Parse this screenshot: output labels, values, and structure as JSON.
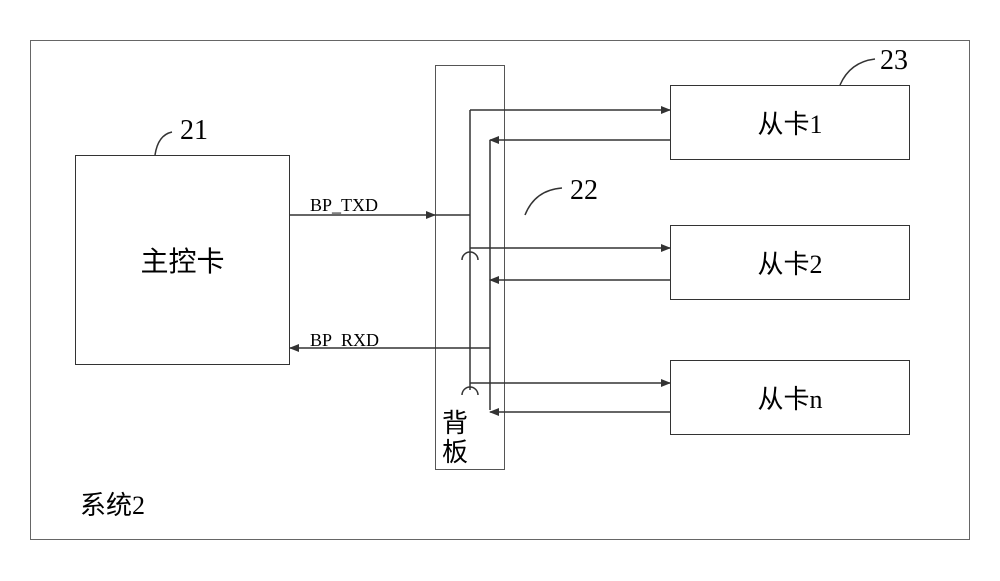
{
  "system": {
    "label": "系统2",
    "master": {
      "label": "主控卡",
      "ref": "21"
    },
    "backplane": {
      "label": "背板",
      "ref": "22"
    },
    "slaves": {
      "ref": "23",
      "items": [
        {
          "label": "从卡1"
        },
        {
          "label": "从卡2"
        },
        {
          "label": "从卡n"
        }
      ]
    },
    "signals": {
      "txd": "BP_TXD",
      "rxd": "BP_RXD"
    }
  }
}
